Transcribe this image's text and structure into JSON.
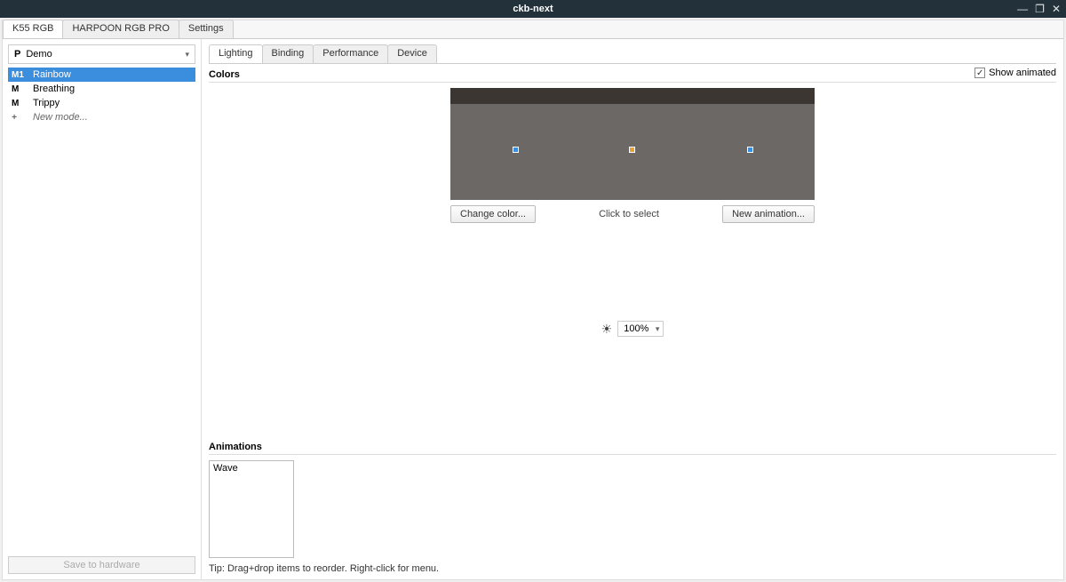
{
  "window": {
    "title": "ckb-next"
  },
  "top_tabs": [
    "K55 RGB",
    "HARPOON RGB PRO",
    "Settings"
  ],
  "sidebar": {
    "profile_prefix": "P",
    "profile_name": "Demo",
    "modes": [
      {
        "marker": "M1",
        "label": "Rainbow",
        "selected": true
      },
      {
        "marker": "M",
        "label": "Breathing"
      },
      {
        "marker": "M",
        "label": "Trippy"
      },
      {
        "marker": "+",
        "label": "New mode...",
        "new": true
      }
    ],
    "save_label": "Save to hardware"
  },
  "inner_tabs": [
    "Lighting",
    "Binding",
    "Performance",
    "Device"
  ],
  "colors": {
    "label": "Colors",
    "show_animated_label": "Show animated",
    "change_color_label": "Change color...",
    "click_to_select": "Click to select",
    "new_animation_label": "New animation..."
  },
  "brightness": {
    "value": "100%"
  },
  "animations": {
    "label": "Animations",
    "items": [
      "Wave"
    ],
    "tip": "Tip: Drag+drop items to reorder. Right-click for menu."
  }
}
